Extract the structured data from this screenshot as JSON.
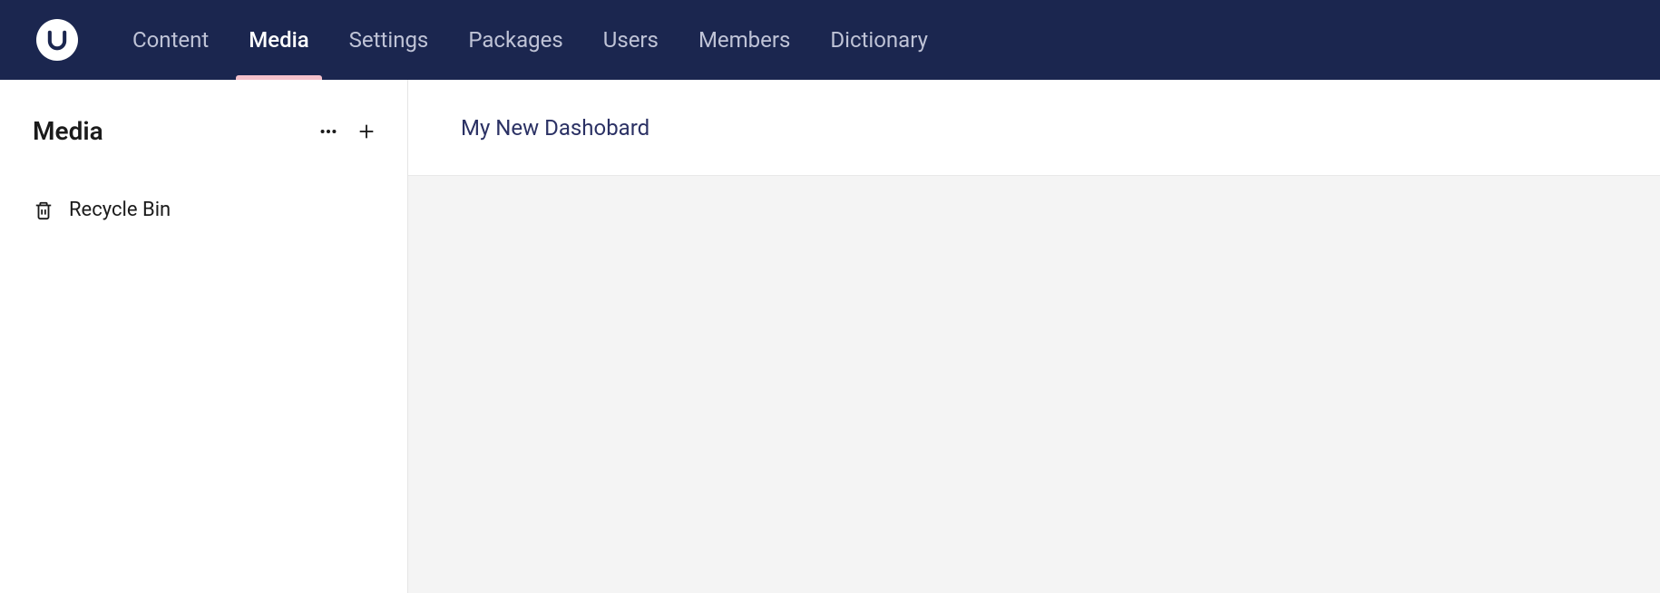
{
  "nav": {
    "items": [
      {
        "label": "Content",
        "active": false
      },
      {
        "label": "Media",
        "active": true
      },
      {
        "label": "Settings",
        "active": false
      },
      {
        "label": "Packages",
        "active": false
      },
      {
        "label": "Users",
        "active": false
      },
      {
        "label": "Members",
        "active": false
      },
      {
        "label": "Dictionary",
        "active": false
      }
    ]
  },
  "sidebar": {
    "title": "Media",
    "tree": [
      {
        "label": "Recycle Bin",
        "icon": "trash-icon"
      }
    ]
  },
  "main": {
    "tabs": [
      {
        "label": "My New Dashobard"
      }
    ]
  }
}
